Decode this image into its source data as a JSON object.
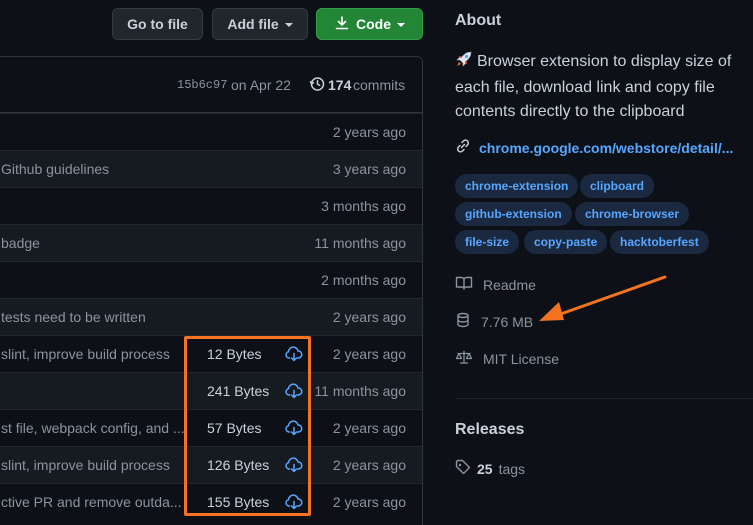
{
  "header": {
    "go_to_file": "Go to file",
    "add_file": "Add file",
    "code": "Code"
  },
  "commit_bar": {
    "sha": "15b6c97",
    "date": "on Apr 22",
    "commit_count": "174",
    "commits_label": "commits"
  },
  "files": [
    {
      "message": "",
      "age": "2 years ago",
      "size": "",
      "has_download": false
    },
    {
      "message": "Github guidelines",
      "age": "3 years ago",
      "size": "",
      "has_download": false
    },
    {
      "message": "",
      "age": "3 months ago",
      "size": "",
      "has_download": false
    },
    {
      "message": "badge",
      "age": "11 months ago",
      "size": "",
      "has_download": false
    },
    {
      "message": "",
      "age": "2 months ago",
      "size": "",
      "has_download": false
    },
    {
      "message": "tests need to be written",
      "age": "2 years ago",
      "size": "",
      "has_download": false
    },
    {
      "message": "slint, improve build process",
      "age": "2 years ago",
      "size": "12 Bytes",
      "has_download": true
    },
    {
      "message": "",
      "age": "11 months ago",
      "size": "241 Bytes",
      "has_download": true
    },
    {
      "message": "st file, webpack config, and ...",
      "age": "2 years ago",
      "size": "57 Bytes",
      "has_download": true
    },
    {
      "message": "slint, improve build process",
      "age": "2 years ago",
      "size": "126 Bytes",
      "has_download": true
    },
    {
      "message": "ctive PR and remove outda...",
      "age": "2 years ago",
      "size": "155 Bytes",
      "has_download": true
    }
  ],
  "about": {
    "title": "About",
    "icon": "rocket-icon",
    "description": "Browser extension to display size of each file, download link and copy file contents directly to the clipboard",
    "website": "chrome.google.com/webstore/detail/...",
    "topics": [
      "chrome-extension",
      "clipboard",
      "github-extension",
      "chrome-browser",
      "file-size",
      "copy-paste",
      "hacktoberfest"
    ],
    "readme": "Readme",
    "repo_size": "7.76 MB",
    "license": "MIT License"
  },
  "releases": {
    "title": "Releases",
    "tag_count": "25",
    "tags_label": "tags"
  },
  "colors": {
    "background": "#0d1117",
    "link": "#58a6ff",
    "green_button": "#238636",
    "annotation": "#f37321",
    "topic_bg": "#1a2940"
  }
}
